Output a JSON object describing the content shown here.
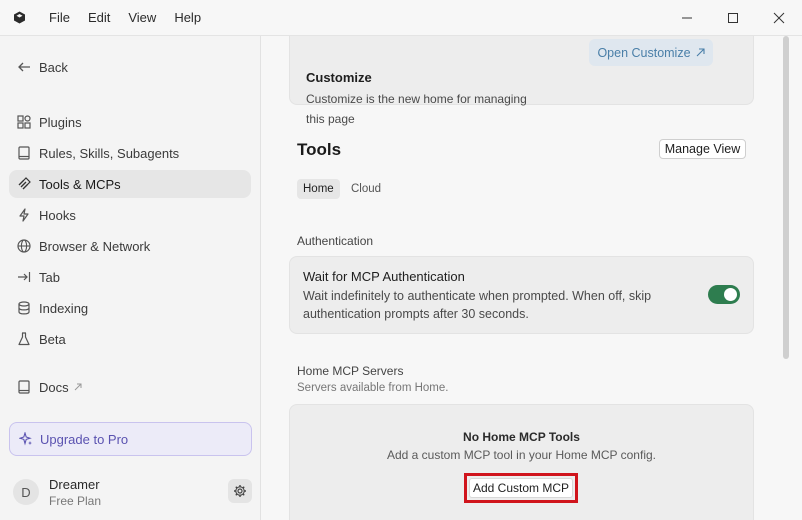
{
  "menu": [
    "File",
    "Edit",
    "View",
    "Help"
  ],
  "sidebar": {
    "back_label": "Back",
    "items": [
      {
        "label": "Plugins",
        "icon": "plugins-icon"
      },
      {
        "label": "Rules, Skills, Subagents",
        "icon": "book-icon"
      },
      {
        "label": "Tools & MCPs",
        "icon": "tools-icon"
      },
      {
        "label": "Hooks",
        "icon": "lightning-icon"
      },
      {
        "label": "Browser & Network",
        "icon": "globe-icon"
      },
      {
        "label": "Tab",
        "icon": "tab-arrow-icon"
      },
      {
        "label": "Indexing",
        "icon": "database-icon"
      },
      {
        "label": "Beta",
        "icon": "flask-icon"
      }
    ],
    "docs_label": "Docs",
    "upgrade_label": "Upgrade to Pro",
    "user": {
      "initial": "D",
      "name": "Dreamer",
      "plan": "Free Plan"
    }
  },
  "customize": {
    "title": "Customize",
    "description": "Customize is the new home for managing this page",
    "open_label": "Open Customize"
  },
  "tools": {
    "title": "Tools",
    "manage_label": "Manage View",
    "tabs": [
      "Home",
      "Cloud"
    ],
    "auth_section_label": "Authentication",
    "auth_title": "Wait for MCP Authentication",
    "auth_description": "Wait indefinitely to authenticate when prompted. When off, skip authentication prompts after 30 seconds.",
    "auth_enabled": true,
    "servers_title": "Home MCP Servers",
    "servers_subtitle": "Servers available from Home.",
    "empty_title": "No Home MCP Tools",
    "empty_description": "Add a custom MCP tool in your Home MCP config.",
    "add_label": "Add Custom MCP"
  },
  "colors": {
    "accent": "#2e7d4f",
    "highlight": "#d0141c",
    "upgrade": "#5a52b0"
  }
}
